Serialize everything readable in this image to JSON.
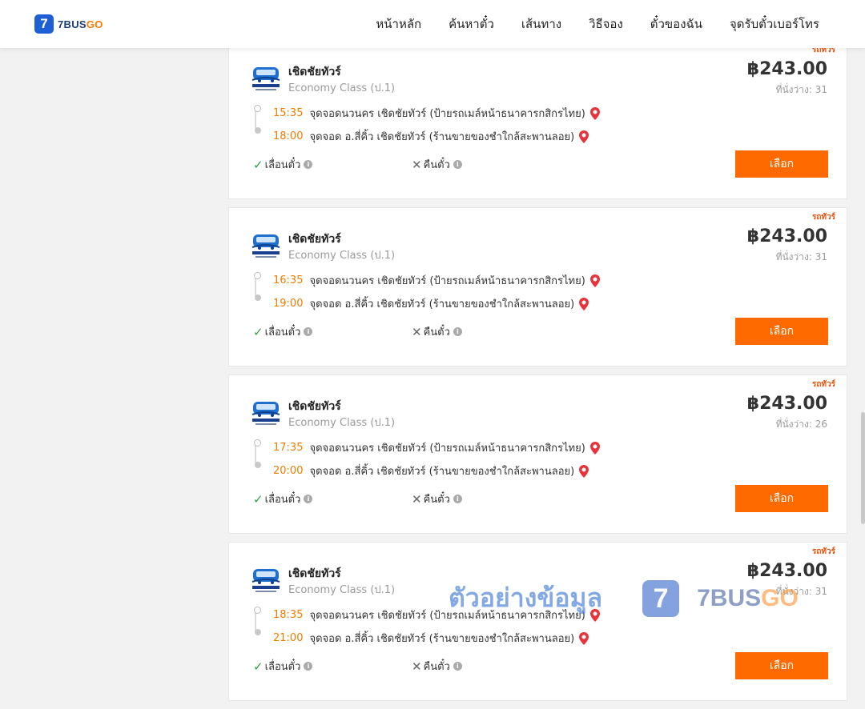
{
  "header": {
    "logo_mark": "7",
    "logo_text_a": "7BUS",
    "logo_text_b": "GO",
    "nav": [
      {
        "label": "หน้าหลัก"
      },
      {
        "label": "ค้นหาตั๋ว"
      },
      {
        "label": "เส้นทาง"
      },
      {
        "label": "วิธีจอง"
      },
      {
        "label": "ตั๋วของฉัน"
      },
      {
        "label": "จุดรับตั๋วเบอร์โทร"
      }
    ]
  },
  "trips": [
    {
      "tag": "รถทัวร์",
      "operator": "เชิดชัยทัวร์",
      "class": "Economy Class (ป.1)",
      "price": "฿243.00",
      "seats": "ที่นั่งว่าง: 31",
      "depart_time": "15:35",
      "depart_place": "จุดจอดนวนคร เชิดชัยทัวร์ (ป้ายรถเมล์หน้าธนาคารกสิกรไทย)",
      "arrive_time": "18:00",
      "arrive_place": "จุดจอด อ.สี่คิ้ว เชิดชัยทัวร์ (ร้านขายของชำใกล้สะพานลอย)",
      "feature1": "เลื่อนตั๋ว",
      "feature2": "คืนตั๋ว",
      "button": "เลือก"
    },
    {
      "tag": "รถทัวร์",
      "operator": "เชิดชัยทัวร์",
      "class": "Economy Class (ป.1)",
      "price": "฿243.00",
      "seats": "ที่นั่งว่าง: 31",
      "depart_time": "16:35",
      "depart_place": "จุดจอดนวนคร เชิดชัยทัวร์ (ป้ายรถเมล์หน้าธนาคารกสิกรไทย)",
      "arrive_time": "19:00",
      "arrive_place": "จุดจอด อ.สี่คิ้ว เชิดชัยทัวร์ (ร้านขายของชำใกล้สะพานลอย)",
      "feature1": "เลื่อนตั๋ว",
      "feature2": "คืนตั๋ว",
      "button": "เลือก"
    },
    {
      "tag": "รถทัวร์",
      "operator": "เชิดชัยทัวร์",
      "class": "Economy Class (ป.1)",
      "price": "฿243.00",
      "seats": "ที่นั่งว่าง: 26",
      "depart_time": "17:35",
      "depart_place": "จุดจอดนวนคร เชิดชัยทัวร์ (ป้ายรถเมล์หน้าธนาคารกสิกรไทย)",
      "arrive_time": "20:00",
      "arrive_place": "จุดจอด อ.สี่คิ้ว เชิดชัยทัวร์ (ร้านขายของชำใกล้สะพานลอย)",
      "feature1": "เลื่อนตั๋ว",
      "feature2": "คืนตั๋ว",
      "button": "เลือก"
    },
    {
      "tag": "รถทัวร์",
      "operator": "เชิดชัยทัวร์",
      "class": "Economy Class (ป.1)",
      "price": "฿243.00",
      "seats": "ที่นั่งว่าง: 31",
      "depart_time": "18:35",
      "depart_place": "จุดจอดนวนคร เชิดชัยทัวร์ (ป้ายรถเมล์หน้าธนาคารกสิกรไทย)",
      "arrive_time": "21:00",
      "arrive_place": "จุดจอด อ.สี่คิ้ว เชิดชัยทัวร์ (ร้านขายของชำใกล้สะพานลอย)",
      "feature1": "เลื่อนตั๋ว",
      "feature2": "คืนตั๋ว",
      "button": "เลือก"
    }
  ],
  "watermark": {
    "text": "ตัวอย่างข้อมูล",
    "logo_mark": "7",
    "brand_a": "7BUS",
    "brand_b": "GO"
  },
  "colors": {
    "accent": "#ff6a00",
    "time": "#f07c00",
    "brand_blue": "#1f5fd6",
    "check": "#2aa14a",
    "pin": "#e8323c"
  },
  "icons": [
    "bus-logo-icon",
    "location-pin-icon",
    "check-icon",
    "cross-icon",
    "info-icon"
  ]
}
